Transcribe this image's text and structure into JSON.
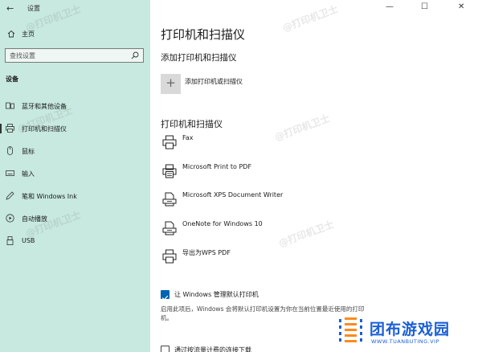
{
  "window": {
    "title": "设置",
    "minimize": "—",
    "maximize": "☐",
    "close": "✕"
  },
  "sidebar": {
    "home_label": "主页",
    "search_placeholder": "查找设置",
    "section_label": "设备",
    "items": [
      {
        "label": "蓝牙和其他设备",
        "icon": "bluetooth-icon"
      },
      {
        "label": "打印机和扫描仪",
        "icon": "printer-icon",
        "active": true
      },
      {
        "label": "鼠标",
        "icon": "mouse-icon"
      },
      {
        "label": "输入",
        "icon": "keyboard-icon"
      },
      {
        "label": "笔和 Windows Ink",
        "icon": "pen-icon"
      },
      {
        "label": "自动播放",
        "icon": "autoplay-icon"
      },
      {
        "label": "USB",
        "icon": "usb-icon"
      }
    ]
  },
  "main": {
    "title": "打印机和扫描仪",
    "add_section_title": "添加打印机和扫描仪",
    "add_label": "添加打印机或扫描仪",
    "list_title": "打印机和扫描仪",
    "printers": [
      {
        "name": "Fax",
        "icon": "fax-icon"
      },
      {
        "name": "Microsoft Print to PDF",
        "icon": "pdf-printer-icon"
      },
      {
        "name": "Microsoft XPS Document Writer",
        "icon": "document-printer-icon"
      },
      {
        "name": "OneNote for Windows 10",
        "icon": "document-printer-icon"
      },
      {
        "name": "导出为WPS PDF",
        "icon": "printer-icon"
      }
    ],
    "default_printer_label": "让 Windows 管理默认打印机",
    "default_printer_checked": true,
    "default_printer_desc": "启用此项后，Windows 会将默认打印机设置为你在当前位置最近使用的打印机。",
    "metered_label": "通过按流量计费的连接下载",
    "metered_checked": false
  },
  "watermark": "@打印机卫士",
  "brand": {
    "name_cn": "团布游戏园",
    "name_en": "WWW.TUANBUTING.VIP",
    "color": "#1a5fd6"
  }
}
